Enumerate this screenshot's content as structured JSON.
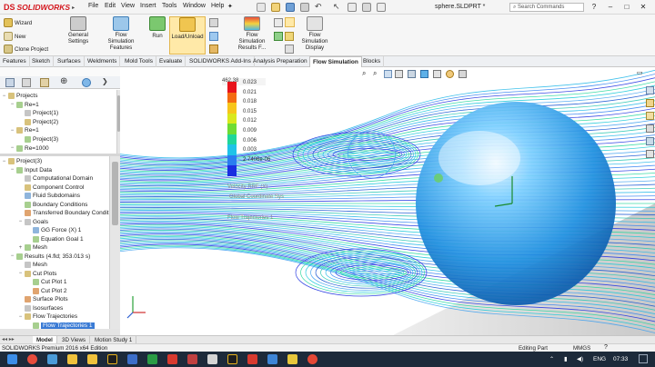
{
  "app": {
    "logo_mark": "DS",
    "logo_name": "SOLIDWORKS",
    "doc_title": "sphere.SLDPRT *",
    "search_placeholder": "Search Commands"
  },
  "menu": [
    "File",
    "Edit",
    "View",
    "Insert",
    "Tools",
    "Window",
    "Help"
  ],
  "window_controls": [
    "?",
    "–",
    "□",
    "✕"
  ],
  "ribbon": {
    "wizard": "Wizard",
    "new": "New",
    "clone": "Clone Project",
    "general_settings": [
      "General",
      "Settings"
    ],
    "fs_features": [
      "Flow",
      "Simulation",
      "Features"
    ],
    "run": "Run",
    "load_unload": "Load/Unload",
    "results_f": [
      "Flow",
      "Simulation",
      "Results F..."
    ],
    "fs_display": [
      "Flow",
      "Simulation",
      "Display"
    ]
  },
  "command_tabs": [
    "Features",
    "Sketch",
    "Surfaces",
    "Weldments",
    "Mold Tools",
    "Evaluate",
    "SOLIDWORKS Add-Ins",
    "Analysis Preparation",
    "Flow Simulation",
    "Blocks"
  ],
  "active_command_tab": "Flow Simulation",
  "tree1": [
    {
      "label": "Projects",
      "level": 0,
      "glyph": "-"
    },
    {
      "label": "Re=1",
      "level": 1,
      "glyph": "-"
    },
    {
      "label": "Project(1)",
      "level": 2,
      "glyph": ""
    },
    {
      "label": "Project(2)",
      "level": 2,
      "glyph": ""
    },
    {
      "label": "Re=1",
      "level": 1,
      "glyph": "-"
    },
    {
      "label": "Project(3)",
      "level": 2,
      "glyph": ""
    },
    {
      "label": "Re=1000",
      "level": 1,
      "glyph": "-"
    }
  ],
  "tree2": [
    {
      "label": "Project(3)",
      "level": 0,
      "glyph": "-",
      "sel": false
    },
    {
      "label": "Input Data",
      "level": 1,
      "glyph": "-",
      "sel": false
    },
    {
      "label": "Computational Domain",
      "level": 2,
      "glyph": "",
      "sel": false
    },
    {
      "label": "Component Control",
      "level": 2,
      "glyph": "",
      "sel": false
    },
    {
      "label": "Fluid Subdomains",
      "level": 2,
      "glyph": "",
      "sel": false
    },
    {
      "label": "Boundary Conditions",
      "level": 2,
      "glyph": "",
      "sel": false
    },
    {
      "label": "Transferred Boundary Condit",
      "level": 2,
      "glyph": "",
      "sel": false
    },
    {
      "label": "Goals",
      "level": 2,
      "glyph": "-",
      "sel": false
    },
    {
      "label": "GG Force (X) 1",
      "level": 3,
      "glyph": "",
      "sel": false
    },
    {
      "label": "Equation Goal 1",
      "level": 3,
      "glyph": "",
      "sel": false
    },
    {
      "label": "Mesh",
      "level": 2,
      "glyph": "+",
      "sel": false
    },
    {
      "label": "Results (4.fld; 353.013 s)",
      "level": 1,
      "glyph": "-",
      "sel": false
    },
    {
      "label": "Mesh",
      "level": 2,
      "glyph": "",
      "sel": false
    },
    {
      "label": "Cut Plots",
      "level": 2,
      "glyph": "-",
      "sel": false
    },
    {
      "label": "Cut Plot 1",
      "level": 3,
      "glyph": "",
      "sel": false
    },
    {
      "label": "Cut Plot 2",
      "level": 3,
      "glyph": "",
      "sel": false
    },
    {
      "label": "Surface Plots",
      "level": 2,
      "glyph": "",
      "sel": false
    },
    {
      "label": "Isosurfaces",
      "level": 2,
      "glyph": "",
      "sel": false
    },
    {
      "label": "Flow Trajectories",
      "level": 2,
      "glyph": "-",
      "sel": false
    },
    {
      "label": "Flow Trajectories 1",
      "level": 3,
      "glyph": "",
      "sel": true
    }
  ],
  "legend": {
    "max_label": "462.38",
    "values": [
      "0.023",
      "0.021",
      "0.018",
      "0.015",
      "0.012",
      "0.009",
      "0.006",
      "0.003",
      "2.7406e-06"
    ],
    "colors": [
      "#e8141c",
      "#f46b12",
      "#f7c51a",
      "#d9e81d",
      "#6fdc34",
      "#20d69a",
      "#1fc3e8",
      "#2a7df0",
      "#1a2ee0"
    ]
  },
  "ghost_text": [
    "Velocity RRF (X)",
    "Global Coordinate Sys",
    "Flow Trajectories 1"
  ],
  "bottom_tabs": [
    "Model",
    "3D Views",
    "Motion Study 1"
  ],
  "active_bottom_tab": "Model",
  "status": {
    "edition": "SOLIDWORKS Premium 2016 x64 Edition",
    "mode": "Editing Part",
    "units": "MMGS"
  },
  "taskbar": {
    "lang": "ENG",
    "time": "07:33"
  }
}
